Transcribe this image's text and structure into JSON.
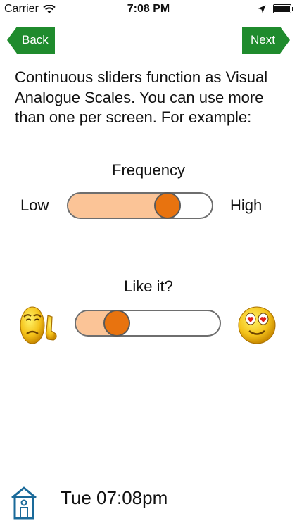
{
  "status_bar": {
    "carrier": "Carrier",
    "time": "7:08 PM"
  },
  "nav": {
    "back_label": "Back",
    "next_label": "Next",
    "button_color": "#1f8b2d"
  },
  "instructions": "Continuous sliders function as Visual Analogue Scales. You can use more than one per screen. For example:",
  "scales": [
    {
      "title": "Frequency",
      "left_label": "Low",
      "right_label": "High",
      "value": 0.73
    },
    {
      "title": "Like it?",
      "left_icon": "unhappy-face-thumbs-down-icon",
      "right_icon": "love-eyes-face-icon",
      "value": 0.24
    }
  ],
  "colors": {
    "slider_fill": "#fbc497",
    "slider_thumb": "#e8730f",
    "home_icon": "#1a6a9a"
  },
  "footer": {
    "time": "Tue 07:08pm"
  }
}
